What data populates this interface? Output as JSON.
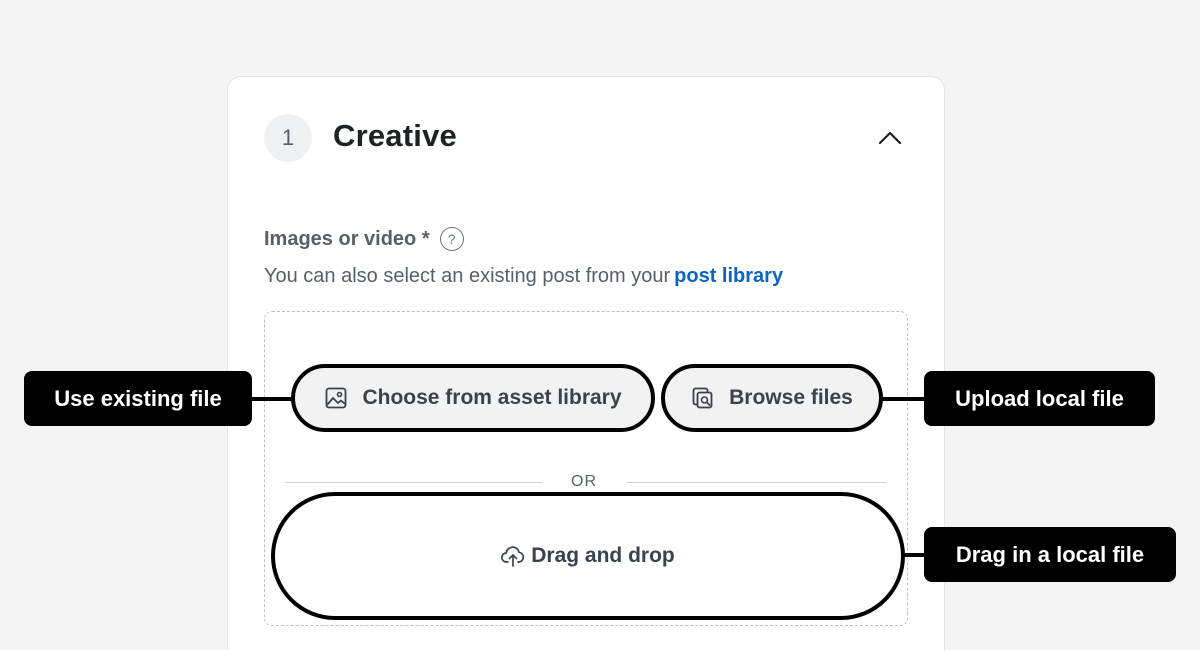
{
  "section": {
    "step_number": "1",
    "title": "Creative",
    "collapse_icon": "chevron-up-icon"
  },
  "field": {
    "label": "Images or video *",
    "help_icon": "?",
    "helper_text": "You can also select an existing post from your",
    "helper_link": "post library"
  },
  "upload": {
    "asset_library_label": "Choose from asset library",
    "asset_library_icon": "image-icon",
    "browse_label": "Browse files",
    "browse_icon": "file-search-icon",
    "or_text": "OR",
    "drag_drop_label": "Drag and drop",
    "drag_drop_icon": "cloud-upload-icon"
  },
  "callouts": {
    "use_existing": "Use existing file",
    "upload_local": "Upload local file",
    "drag_local": "Drag in a local file"
  },
  "colors": {
    "background": "#f4f4f5",
    "card": "#ffffff",
    "link": "#0a66c2",
    "callout_bg": "#000000",
    "callout_text": "#ffffff"
  }
}
